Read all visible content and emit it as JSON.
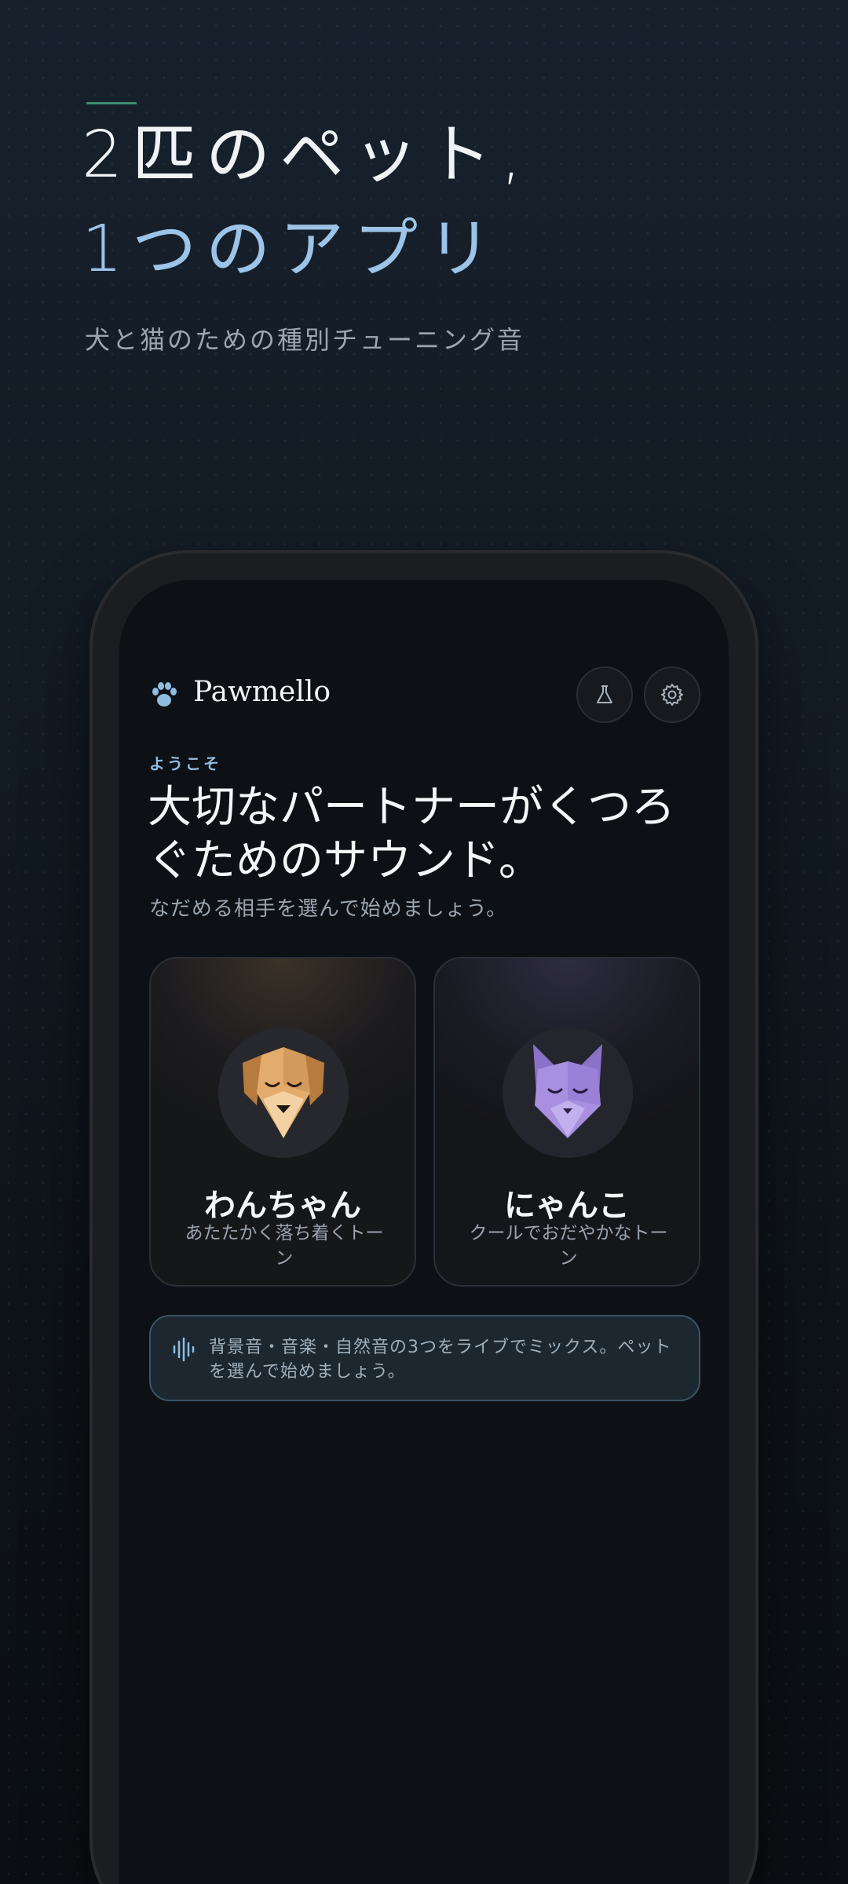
{
  "hero": {
    "line1": "2匹のペット,",
    "line2": "1つのアプリ",
    "subtitle": "犬と猫のための種別チューニング音"
  },
  "app": {
    "name": "Pawmello",
    "welcome_label": "ようこそ",
    "title": "大切なパートナーがくつろぐためのサウンド。",
    "subtitle": "なだめる相手を選んで始めましょう。",
    "pets": [
      {
        "name": "わんちゃん",
        "description": "あたたかく落ち着くトーン"
      },
      {
        "name": "にゃんこ",
        "description": "クールでおだやかなトーン"
      }
    ],
    "info_text": "背景音・音楽・自然音の3つをライブでミックス。ペットを選んで始めましょう。"
  },
  "icons": {
    "brand": "paw-icon",
    "lab": "flask-icon",
    "settings": "gear-icon",
    "info": "waveform-icon"
  },
  "colors": {
    "accent_blue": "#9cc4e8",
    "accent_green": "#3d8c72",
    "dog_tan": "#e0a868",
    "cat_purple": "#a98fe0"
  }
}
